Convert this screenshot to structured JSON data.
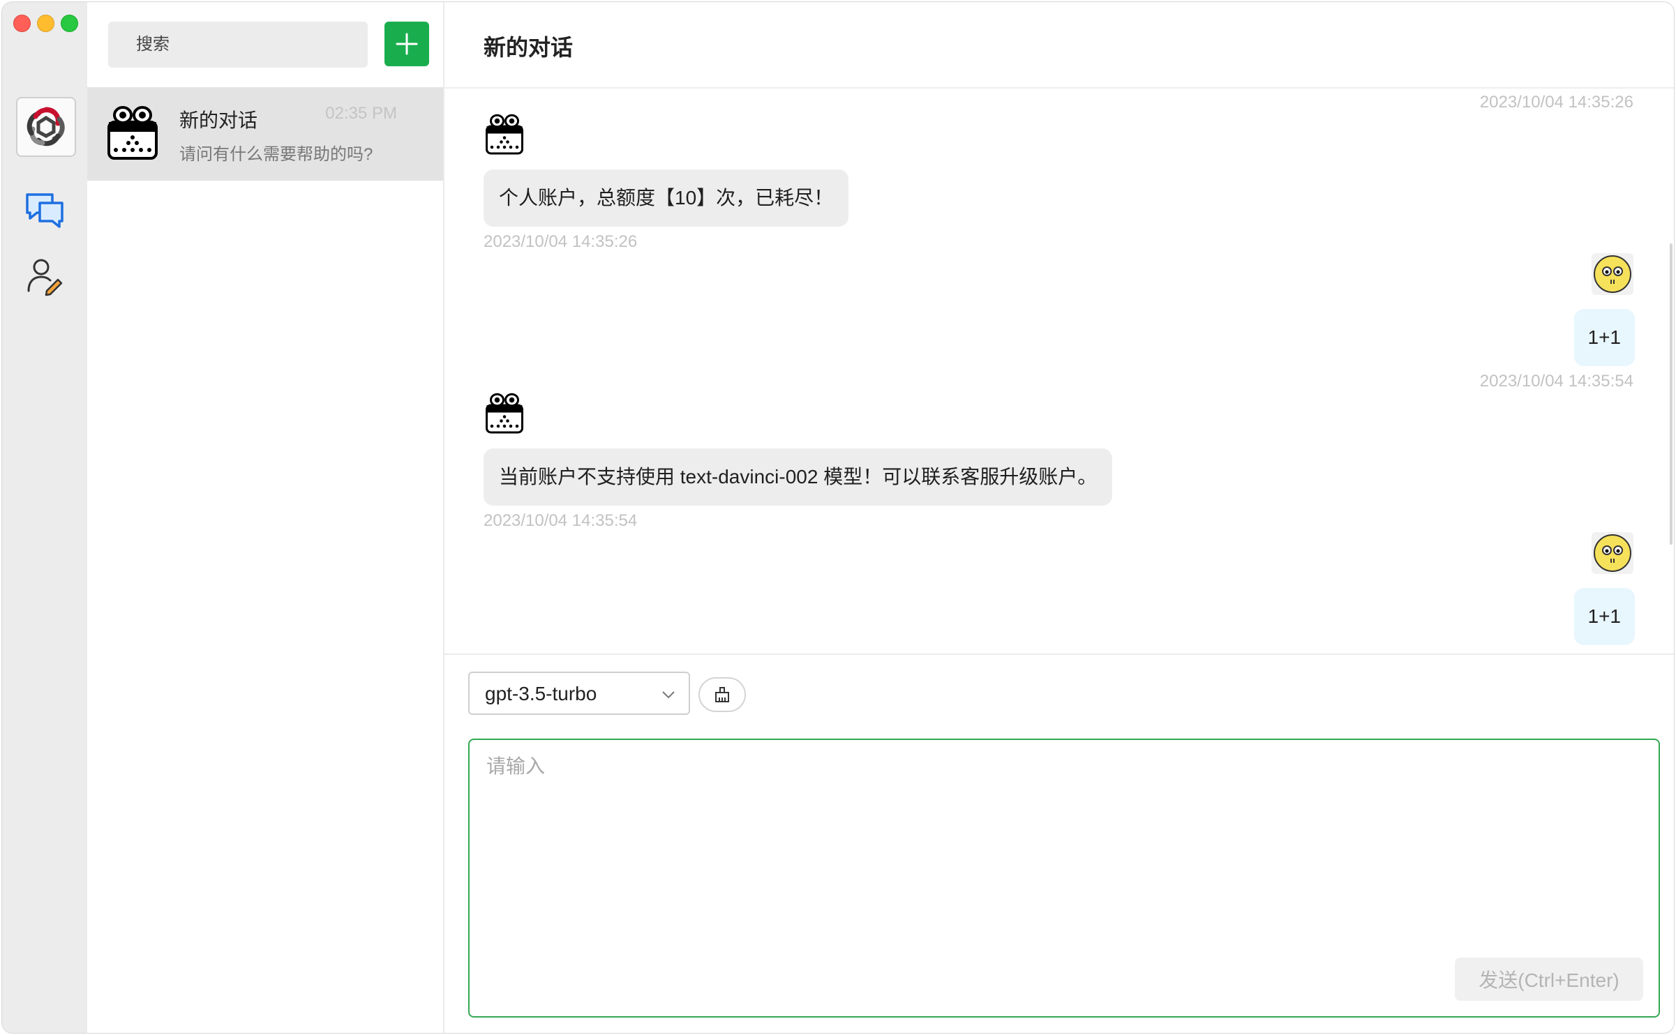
{
  "sidebar": {
    "app_logo": "openai-logo-icon",
    "nav": [
      {
        "icon": "chat-icon",
        "active": true
      },
      {
        "icon": "user-edit-icon",
        "active": false
      }
    ]
  },
  "conversations": {
    "search_placeholder": "搜索",
    "new_button_icon": "plus-icon",
    "items": [
      {
        "title": "新的对话",
        "time": "02:35 PM",
        "preview": "请问有什么需要帮助的吗?"
      }
    ]
  },
  "chat": {
    "title": "新的对话",
    "messages": [
      {
        "role": "system",
        "time": "2023/10/04 14:35:26"
      },
      {
        "role": "bot",
        "text": "个人账户，总额度【10】次，已耗尽！",
        "time": "2023/10/04 14:35:26"
      },
      {
        "role": "user",
        "text": "1+1",
        "time": "2023/10/04 14:35:54"
      },
      {
        "role": "bot",
        "text": "当前账户不支持使用 text-davinci-002 模型！可以联系客服升级账户。",
        "time": "2023/10/04 14:35:54"
      },
      {
        "role": "user",
        "text": "1+1"
      }
    ],
    "model": "gpt-3.5-turbo",
    "clear_icon": "broom-icon",
    "input_placeholder": "请输入",
    "send_label": "发送(Ctrl+Enter)"
  },
  "colors": {
    "accent_green": "#1aad4e",
    "input_border": "#34a853",
    "user_bubble": "#e8f6fe",
    "bot_bubble": "#ededed"
  }
}
